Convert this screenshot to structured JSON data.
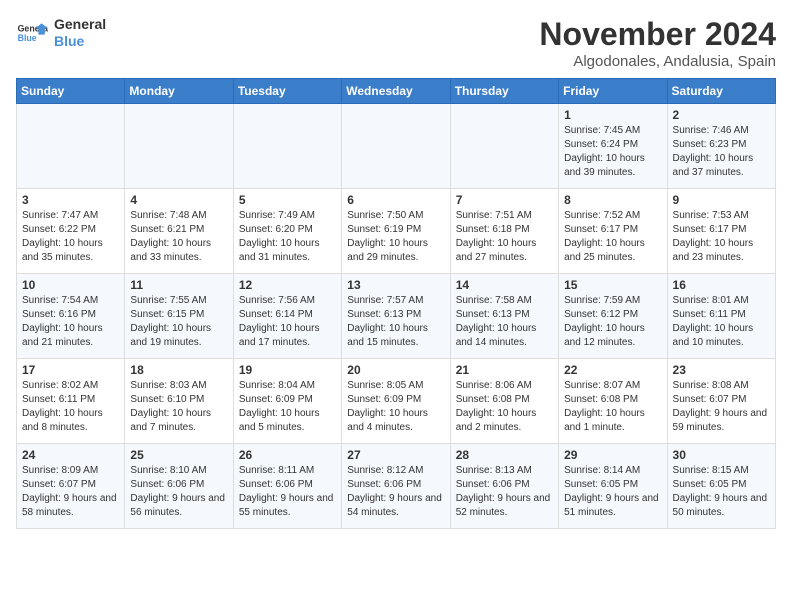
{
  "header": {
    "logo_general": "General",
    "logo_blue": "Blue",
    "month": "November 2024",
    "location": "Algodonales, Andalusia, Spain"
  },
  "days_of_week": [
    "Sunday",
    "Monday",
    "Tuesday",
    "Wednesday",
    "Thursday",
    "Friday",
    "Saturday"
  ],
  "weeks": [
    [
      {
        "day": "",
        "info": ""
      },
      {
        "day": "",
        "info": ""
      },
      {
        "day": "",
        "info": ""
      },
      {
        "day": "",
        "info": ""
      },
      {
        "day": "",
        "info": ""
      },
      {
        "day": "1",
        "info": "Sunrise: 7:45 AM\nSunset: 6:24 PM\nDaylight: 10 hours and 39 minutes."
      },
      {
        "day": "2",
        "info": "Sunrise: 7:46 AM\nSunset: 6:23 PM\nDaylight: 10 hours and 37 minutes."
      }
    ],
    [
      {
        "day": "3",
        "info": "Sunrise: 7:47 AM\nSunset: 6:22 PM\nDaylight: 10 hours and 35 minutes."
      },
      {
        "day": "4",
        "info": "Sunrise: 7:48 AM\nSunset: 6:21 PM\nDaylight: 10 hours and 33 minutes."
      },
      {
        "day": "5",
        "info": "Sunrise: 7:49 AM\nSunset: 6:20 PM\nDaylight: 10 hours and 31 minutes."
      },
      {
        "day": "6",
        "info": "Sunrise: 7:50 AM\nSunset: 6:19 PM\nDaylight: 10 hours and 29 minutes."
      },
      {
        "day": "7",
        "info": "Sunrise: 7:51 AM\nSunset: 6:18 PM\nDaylight: 10 hours and 27 minutes."
      },
      {
        "day": "8",
        "info": "Sunrise: 7:52 AM\nSunset: 6:17 PM\nDaylight: 10 hours and 25 minutes."
      },
      {
        "day": "9",
        "info": "Sunrise: 7:53 AM\nSunset: 6:17 PM\nDaylight: 10 hours and 23 minutes."
      }
    ],
    [
      {
        "day": "10",
        "info": "Sunrise: 7:54 AM\nSunset: 6:16 PM\nDaylight: 10 hours and 21 minutes."
      },
      {
        "day": "11",
        "info": "Sunrise: 7:55 AM\nSunset: 6:15 PM\nDaylight: 10 hours and 19 minutes."
      },
      {
        "day": "12",
        "info": "Sunrise: 7:56 AM\nSunset: 6:14 PM\nDaylight: 10 hours and 17 minutes."
      },
      {
        "day": "13",
        "info": "Sunrise: 7:57 AM\nSunset: 6:13 PM\nDaylight: 10 hours and 15 minutes."
      },
      {
        "day": "14",
        "info": "Sunrise: 7:58 AM\nSunset: 6:13 PM\nDaylight: 10 hours and 14 minutes."
      },
      {
        "day": "15",
        "info": "Sunrise: 7:59 AM\nSunset: 6:12 PM\nDaylight: 10 hours and 12 minutes."
      },
      {
        "day": "16",
        "info": "Sunrise: 8:01 AM\nSunset: 6:11 PM\nDaylight: 10 hours and 10 minutes."
      }
    ],
    [
      {
        "day": "17",
        "info": "Sunrise: 8:02 AM\nSunset: 6:11 PM\nDaylight: 10 hours and 8 minutes."
      },
      {
        "day": "18",
        "info": "Sunrise: 8:03 AM\nSunset: 6:10 PM\nDaylight: 10 hours and 7 minutes."
      },
      {
        "day": "19",
        "info": "Sunrise: 8:04 AM\nSunset: 6:09 PM\nDaylight: 10 hours and 5 minutes."
      },
      {
        "day": "20",
        "info": "Sunrise: 8:05 AM\nSunset: 6:09 PM\nDaylight: 10 hours and 4 minutes."
      },
      {
        "day": "21",
        "info": "Sunrise: 8:06 AM\nSunset: 6:08 PM\nDaylight: 10 hours and 2 minutes."
      },
      {
        "day": "22",
        "info": "Sunrise: 8:07 AM\nSunset: 6:08 PM\nDaylight: 10 hours and 1 minute."
      },
      {
        "day": "23",
        "info": "Sunrise: 8:08 AM\nSunset: 6:07 PM\nDaylight: 9 hours and 59 minutes."
      }
    ],
    [
      {
        "day": "24",
        "info": "Sunrise: 8:09 AM\nSunset: 6:07 PM\nDaylight: 9 hours and 58 minutes."
      },
      {
        "day": "25",
        "info": "Sunrise: 8:10 AM\nSunset: 6:06 PM\nDaylight: 9 hours and 56 minutes."
      },
      {
        "day": "26",
        "info": "Sunrise: 8:11 AM\nSunset: 6:06 PM\nDaylight: 9 hours and 55 minutes."
      },
      {
        "day": "27",
        "info": "Sunrise: 8:12 AM\nSunset: 6:06 PM\nDaylight: 9 hours and 54 minutes."
      },
      {
        "day": "28",
        "info": "Sunrise: 8:13 AM\nSunset: 6:06 PM\nDaylight: 9 hours and 52 minutes."
      },
      {
        "day": "29",
        "info": "Sunrise: 8:14 AM\nSunset: 6:05 PM\nDaylight: 9 hours and 51 minutes."
      },
      {
        "day": "30",
        "info": "Sunrise: 8:15 AM\nSunset: 6:05 PM\nDaylight: 9 hours and 50 minutes."
      }
    ]
  ]
}
